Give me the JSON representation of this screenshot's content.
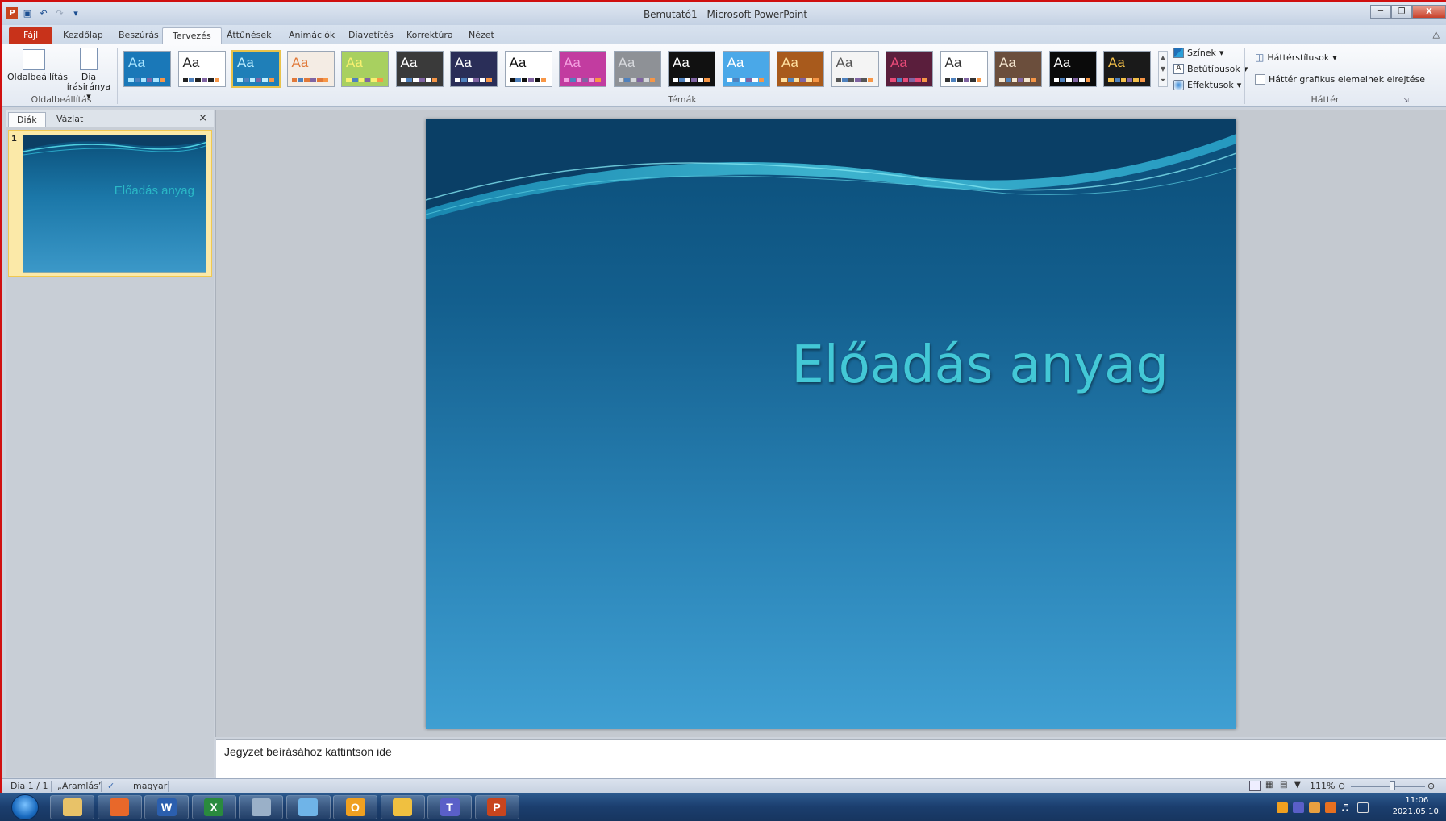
{
  "window": {
    "title": "Bemutató1 - Microsoft PowerPoint",
    "minimize_icon": "minimize-icon",
    "restore_icon": "restore-icon",
    "close_label": "X"
  },
  "qat": {
    "app_icon": "powerpoint-icon",
    "items": [
      "save-icon",
      "undo-icon",
      "redo-icon",
      "customize-icon"
    ]
  },
  "tabs": [
    {
      "label": "Fájl"
    },
    {
      "label": "Kezdőlap"
    },
    {
      "label": "Beszúrás"
    },
    {
      "label": "Tervezés"
    },
    {
      "label": "Áttűnések"
    },
    {
      "label": "Animációk"
    },
    {
      "label": "Diavetítés"
    },
    {
      "label": "Korrektúra"
    },
    {
      "label": "Nézet"
    }
  ],
  "active_tab": "Tervezés",
  "ribbon": {
    "page_setup": {
      "group_label": "Oldalbeállítás",
      "page_setup_label": "Oldalbeállítás",
      "orientation_line1": "Dia",
      "orientation_line2": "írásiránya"
    },
    "themes": {
      "group_label": "Témák",
      "sample": "Aa",
      "items": [
        {
          "bg": "#1a78b8",
          "fg": "#a8e4ff"
        },
        {
          "bg": "#ffffff",
          "fg": "#222222"
        },
        {
          "bg": "#1f7fb8",
          "fg": "#bfefff"
        },
        {
          "bg": "#f4ece4",
          "fg": "#e07838"
        },
        {
          "bg": "#a8d060",
          "fg": "#f8f070"
        },
        {
          "bg": "#3a3a3a",
          "fg": "#ffffff"
        },
        {
          "bg": "#2a2e58",
          "fg": "#ffffff"
        },
        {
          "bg": "#ffffff",
          "fg": "#111111"
        },
        {
          "bg": "#c23ca0",
          "fg": "#f4a0e0"
        },
        {
          "bg": "#8e9196",
          "fg": "#d6d8dc"
        },
        {
          "bg": "#111111",
          "fg": "#ffffff"
        },
        {
          "bg": "#4aa8e8",
          "fg": "#ffffff"
        },
        {
          "bg": "#a85a1c",
          "fg": "#ffe0a0"
        },
        {
          "bg": "#f4f4f4",
          "fg": "#555555"
        },
        {
          "bg": "#5a1e3c",
          "fg": "#e84b78"
        },
        {
          "bg": "#ffffff",
          "fg": "#333333"
        },
        {
          "bg": "#6b4e3c",
          "fg": "#f4e6d0"
        },
        {
          "bg": "#0a0a0a",
          "fg": "#ffffff"
        },
        {
          "bg": "#1a1a1a",
          "fg": "#f4c04a"
        }
      ],
      "colors_label": "Színek",
      "fonts_label": "Betűtípusok",
      "effects_label": "Effektusok"
    },
    "background": {
      "group_label": "Háttér",
      "styles_label": "Háttérstílusok",
      "hide_graphics_label": "Háttér grafikus elemeinek elrejtése",
      "hide_graphics_checked": false
    }
  },
  "left_pane": {
    "tabs": [
      "Diák",
      "Vázlat"
    ],
    "close_label": "×",
    "slides": [
      {
        "number": "1",
        "title": "Előadás anyag"
      }
    ]
  },
  "slide": {
    "title": "Előadás anyag"
  },
  "notes": {
    "placeholder": "Jegyzet beírásához kattintson ide"
  },
  "status": {
    "slide_info": "Dia 1 / 1",
    "theme_name": "„Áramlás”",
    "language": "magyar",
    "zoom": "111%",
    "zoom_fraction": 0.55
  },
  "taskbar": {
    "apps": [
      {
        "name": "explorer",
        "icon": "folder-icon",
        "color": "#e8c268",
        "glyph": ""
      },
      {
        "name": "firefox",
        "icon": "firefox-icon",
        "color": "#e8682a",
        "glyph": ""
      },
      {
        "name": "word",
        "icon": "word-icon",
        "color": "#2b5fae",
        "glyph": "W"
      },
      {
        "name": "excel",
        "icon": "excel-icon",
        "color": "#2a8a3e",
        "glyph": "X"
      },
      {
        "name": "calculator",
        "icon": "calculator-icon",
        "color": "#9ab0c8",
        "glyph": ""
      },
      {
        "name": "notes",
        "icon": "notepad-icon",
        "color": "#6fb4e8",
        "glyph": ""
      },
      {
        "name": "outlook",
        "icon": "outlook-icon",
        "color": "#f0a020",
        "glyph": "O"
      },
      {
        "name": "onedrive",
        "icon": "cloud-folder-icon",
        "color": "#f0c040",
        "glyph": ""
      },
      {
        "name": "teams",
        "icon": "teams-icon",
        "color": "#5a5fc8",
        "glyph": "T"
      },
      {
        "name": "powerpoint",
        "icon": "powerpoint-icon",
        "color": "#c8451e",
        "glyph": "P"
      }
    ],
    "clock_time": "11:06",
    "clock_date": "2021.05.10."
  }
}
